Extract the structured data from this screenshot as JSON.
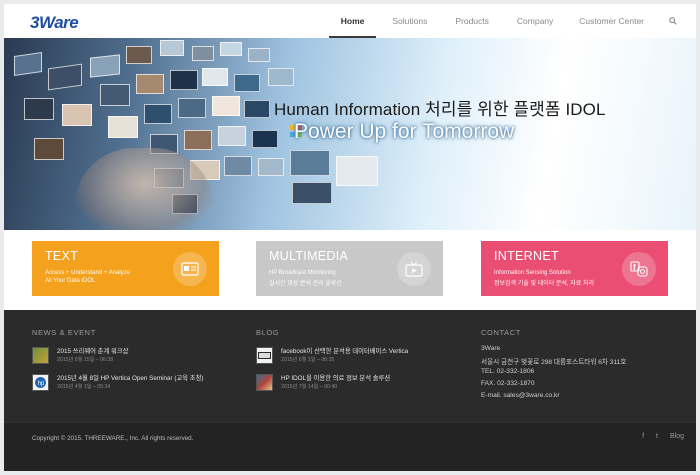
{
  "header": {
    "logo_text": "3Ware",
    "nav": [
      {
        "label": "Home",
        "active": true
      },
      {
        "label": "Solutions",
        "active": false
      },
      {
        "label": "Products",
        "active": false
      },
      {
        "label": "Company",
        "active": false
      },
      {
        "label": "Customer Center",
        "active": false
      }
    ],
    "search_icon": "search-icon"
  },
  "hero": {
    "headline": "Human Information 처리를 위한 플랫폼 IDOL",
    "tagline": "Power Up for Tomorrow"
  },
  "cards": [
    {
      "title": "TEXT",
      "line1": "Access + Understand + Analyze",
      "line2": "All Your Data IDOL",
      "color": "#f4a21e",
      "icon": "text-card-icon"
    },
    {
      "title": "MULTIMEDIA",
      "line1": "HP Broadcast Monitoring",
      "line2": "실시간 영상 분석 관리 솔루션",
      "color": "#c8c8c8",
      "icon": "tv-icon"
    },
    {
      "title": "INTERNET",
      "line1": "Information Sensing Solution",
      "line2": "정보검색 기술 및 데이터 분석, 자료 처리",
      "color": "#ea4f73",
      "icon": "social-icon"
    }
  ],
  "footer": {
    "news": {
      "heading": "NEWS & EVENT",
      "items": [
        {
          "title": "2015 쓰리웨어 춘계 워크샵",
          "date": "2015년 6월 15일 – 06:38"
        },
        {
          "title": "2015년 4월 8일 HP Vertica Open Seminar (교육 초청)",
          "date": "2015년 4월 1일 – 05:34"
        }
      ]
    },
    "blog": {
      "heading": "BLOG",
      "items": [
        {
          "title": "facebook이 선택한 분석용 데이터베이스 Vertica",
          "date": "2015년 6월 1일 – 06:35"
        },
        {
          "title": "HP IDOL을 이용한 의료 정보 분석 솔루션",
          "date": "2015년 7월 14일 – 00:40"
        }
      ]
    },
    "contact": {
      "heading": "CONTACT",
      "lines": [
        "3Ware",
        "서울시 금천구 벚꽃로 298 대륭포스트타워 6차 311호",
        "TEL. 02-332-1806",
        "FAX. 02-332-1870",
        "E-mail. sales@3ware.co.kr"
      ]
    }
  },
  "bottom": {
    "copyright": "Copyright © 2015. THREEWARE., Inc. All rights reserved.",
    "social": [
      "f",
      "t",
      "Blog"
    ]
  }
}
